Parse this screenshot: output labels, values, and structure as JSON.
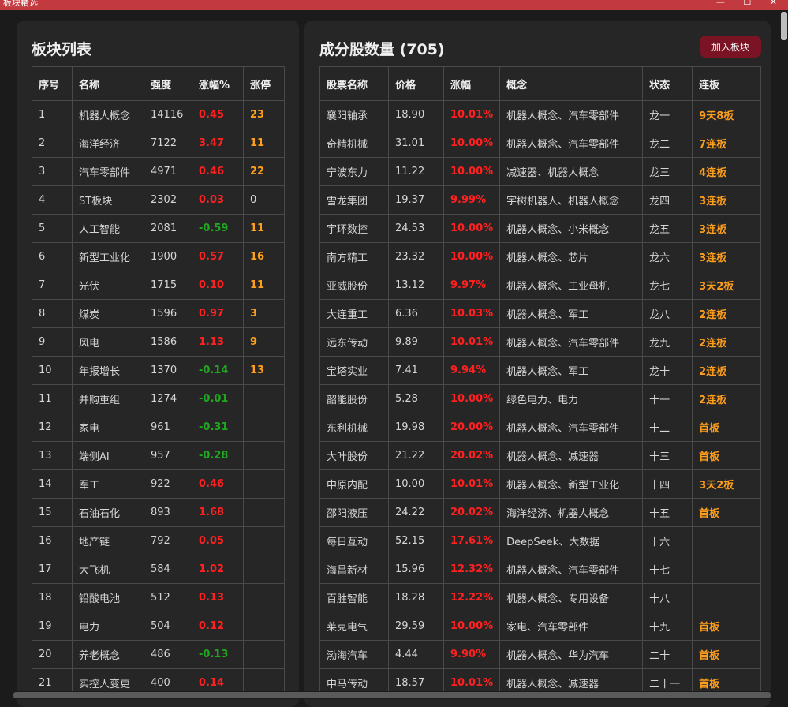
{
  "window": {
    "title": "板块精选",
    "controls": "— ☐ ✕"
  },
  "colors": {
    "up": "#ff2020",
    "down": "#1fa81f",
    "limit": "#ff9f1c",
    "accent": "#c23a3f"
  },
  "sectors": {
    "title": "板块列表",
    "headers": [
      "序号",
      "名称",
      "强度",
      "涨幅%",
      "涨停"
    ],
    "rows": [
      [
        "1",
        "机器人概念",
        "14116",
        "0.45",
        "23"
      ],
      [
        "2",
        "海洋经济",
        "7122",
        "3.47",
        "11"
      ],
      [
        "3",
        "汽车零部件",
        "4971",
        "0.46",
        "22"
      ],
      [
        "4",
        "ST板块",
        "2302",
        "0.03",
        "0"
      ],
      [
        "5",
        "人工智能",
        "2081",
        "-0.59",
        "11"
      ],
      [
        "6",
        "新型工业化",
        "1900",
        "0.57",
        "16"
      ],
      [
        "7",
        "光伏",
        "1715",
        "0.10",
        "11"
      ],
      [
        "8",
        "煤炭",
        "1596",
        "0.97",
        "3"
      ],
      [
        "9",
        "风电",
        "1586",
        "1.13",
        "9"
      ],
      [
        "10",
        "年报增长",
        "1370",
        "-0.14",
        "13"
      ],
      [
        "11",
        "并购重组",
        "1274",
        "-0.01",
        ""
      ],
      [
        "12",
        "家电",
        "961",
        "-0.31",
        ""
      ],
      [
        "13",
        "端侧AI",
        "957",
        "-0.28",
        ""
      ],
      [
        "14",
        "军工",
        "922",
        "0.46",
        ""
      ],
      [
        "15",
        "石油石化",
        "893",
        "1.68",
        ""
      ],
      [
        "16",
        "地产链",
        "792",
        "0.05",
        ""
      ],
      [
        "17",
        "大飞机",
        "584",
        "1.02",
        ""
      ],
      [
        "18",
        "铅酸电池",
        "512",
        "0.13",
        ""
      ],
      [
        "19",
        "电力",
        "504",
        "0.12",
        ""
      ],
      [
        "20",
        "养老概念",
        "486",
        "-0.13",
        ""
      ],
      [
        "21",
        "实控人变更",
        "400",
        "0.14",
        ""
      ]
    ]
  },
  "stocks": {
    "title": "成分股数量 (705)",
    "add_button": "加入板块",
    "headers": [
      "股票名称",
      "价格",
      "涨幅",
      "概念",
      "状态",
      "连板"
    ],
    "rows": [
      [
        "襄阳轴承",
        "18.90",
        "10.01%",
        "机器人概念、汽车零部件",
        "龙一",
        "9天8板"
      ],
      [
        "奇精机械",
        "31.01",
        "10.00%",
        "机器人概念、汽车零部件",
        "龙二",
        "7连板"
      ],
      [
        "宁波东力",
        "11.22",
        "10.00%",
        "减速器、机器人概念",
        "龙三",
        "4连板"
      ],
      [
        "雪龙集团",
        "19.37",
        "9.99%",
        "宇树机器人、机器人概念",
        "龙四",
        "3连板"
      ],
      [
        "宇环数控",
        "24.53",
        "10.00%",
        "机器人概念、小米概念",
        "龙五",
        "3连板"
      ],
      [
        "南方精工",
        "23.32",
        "10.00%",
        "机器人概念、芯片",
        "龙六",
        "3连板"
      ],
      [
        "亚威股份",
        "13.12",
        "9.97%",
        "机器人概念、工业母机",
        "龙七",
        "3天2板"
      ],
      [
        "大连重工",
        "6.36",
        "10.03%",
        "机器人概念、军工",
        "龙八",
        "2连板"
      ],
      [
        "远东传动",
        "9.89",
        "10.01%",
        "机器人概念、汽车零部件",
        "龙九",
        "2连板"
      ],
      [
        "宝塔实业",
        "7.41",
        "9.94%",
        "机器人概念、军工",
        "龙十",
        "2连板"
      ],
      [
        "韶能股份",
        "5.28",
        "10.00%",
        "绿色电力、电力",
        "十一",
        "2连板"
      ],
      [
        "东利机械",
        "19.98",
        "20.00%",
        "机器人概念、汽车零部件",
        "十二",
        "首板"
      ],
      [
        "大叶股份",
        "21.22",
        "20.02%",
        "机器人概念、减速器",
        "十三",
        "首板"
      ],
      [
        "中原内配",
        "10.00",
        "10.01%",
        "机器人概念、新型工业化",
        "十四",
        "3天2板"
      ],
      [
        "邵阳液压",
        "24.22",
        "20.02%",
        "海洋经济、机器人概念",
        "十五",
        "首板"
      ],
      [
        "每日互动",
        "52.15",
        "17.61%",
        "DeepSeek、大数据",
        "十六",
        ""
      ],
      [
        "海昌新材",
        "15.96",
        "12.32%",
        "机器人概念、汽车零部件",
        "十七",
        ""
      ],
      [
        "百胜智能",
        "18.28",
        "12.22%",
        "机器人概念、专用设备",
        "十八",
        ""
      ],
      [
        "莱克电气",
        "29.59",
        "10.00%",
        "家电、汽车零部件",
        "十九",
        "首板"
      ],
      [
        "渤海汽车",
        "4.44",
        "9.90%",
        "机器人概念、华为汽车",
        "二十",
        "首板"
      ],
      [
        "中马传动",
        "18.57",
        "10.01%",
        "机器人概念、减速器",
        "二十一",
        "首板"
      ]
    ]
  }
}
